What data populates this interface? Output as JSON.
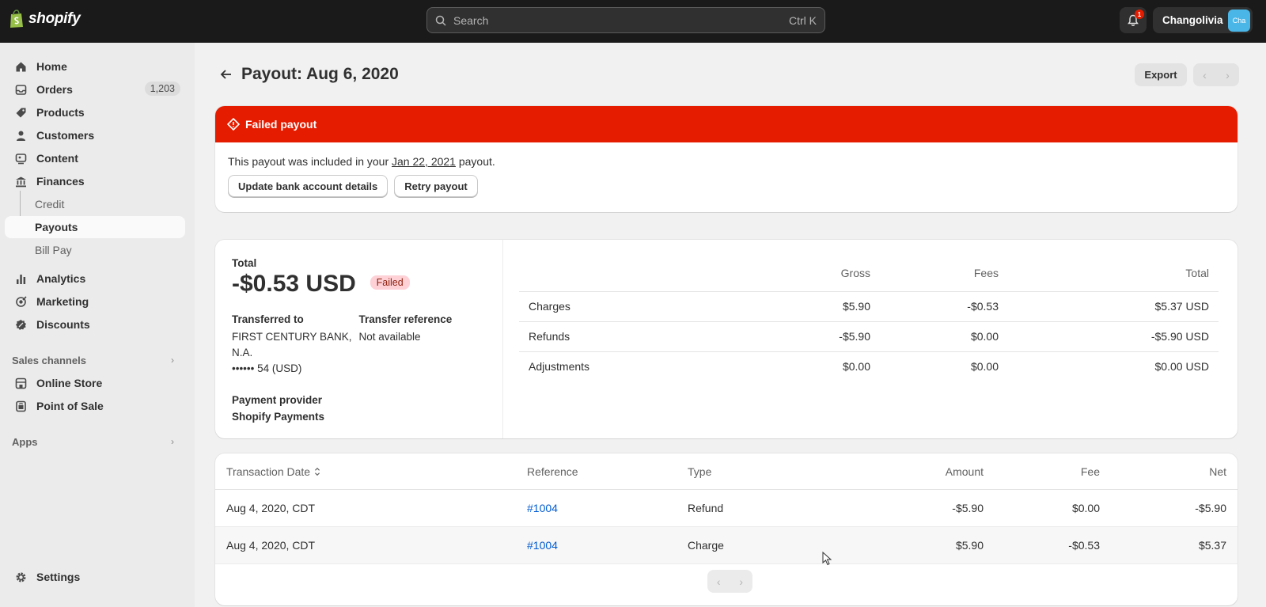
{
  "topbar": {
    "brand": "shopify",
    "search_placeholder": "Search",
    "search_shortcut": "Ctrl K",
    "notification_count": "1",
    "store_name": "Changolivia",
    "avatar_text": "Cha"
  },
  "sidebar": {
    "items": [
      {
        "label": "Home",
        "icon": "home-icon"
      },
      {
        "label": "Orders",
        "icon": "orders-icon",
        "badge": "1,203"
      },
      {
        "label": "Products",
        "icon": "tag-icon"
      },
      {
        "label": "Customers",
        "icon": "person-icon"
      },
      {
        "label": "Content",
        "icon": "content-icon"
      },
      {
        "label": "Finances",
        "icon": "bank-icon"
      },
      {
        "label": "Credit"
      },
      {
        "label": "Payouts"
      },
      {
        "label": "Bill Pay"
      },
      {
        "label": "Analytics",
        "icon": "analytics-icon"
      },
      {
        "label": "Marketing",
        "icon": "marketing-icon"
      },
      {
        "label": "Discounts",
        "icon": "discount-icon"
      }
    ],
    "sales_channels_label": "Sales channels",
    "channels": [
      {
        "label": "Online Store",
        "icon": "store-icon"
      },
      {
        "label": "Point of Sale",
        "icon": "pos-icon"
      }
    ],
    "apps_label": "Apps",
    "settings_label": "Settings"
  },
  "page": {
    "title": "Payout: Aug 6, 2020",
    "export_label": "Export"
  },
  "banner": {
    "title": "Failed payout",
    "text_before": "This payout was included in your ",
    "link": "Jan 22, 2021",
    "text_after": " payout.",
    "update_button": "Update bank account details",
    "retry_button": "Retry payout"
  },
  "summary": {
    "total_label": "Total",
    "total_amount": "-$0.53 USD",
    "status": "Failed",
    "transferred_label": "Transferred to",
    "bank_name": "FIRST CENTURY BANK, N.A.",
    "account": "•••••• 54 (USD)",
    "reference_label": "Transfer reference",
    "reference_value": "Not available",
    "provider_label": "Payment provider",
    "provider_value": "Shopify Payments",
    "table": {
      "headers": {
        "gross": "Gross",
        "fees": "Fees",
        "total": "Total"
      },
      "rows": [
        {
          "name": "Charges",
          "gross": "$5.90",
          "fees": "-$0.53",
          "total": "$5.37 USD"
        },
        {
          "name": "Refunds",
          "gross": "-$5.90",
          "fees": "$0.00",
          "total": "-$5.90 USD"
        },
        {
          "name": "Adjustments",
          "gross": "$0.00",
          "fees": "$0.00",
          "total": "$0.00 USD"
        }
      ]
    }
  },
  "transactions": {
    "headers": {
      "date": "Transaction Date",
      "reference": "Reference",
      "type": "Type",
      "amount": "Amount",
      "fee": "Fee",
      "net": "Net"
    },
    "rows": [
      {
        "date": "Aug 4, 2020, CDT",
        "reference": "#1004",
        "type": "Refund",
        "amount": "-$5.90",
        "fee": "$0.00",
        "net": "-$5.90"
      },
      {
        "date": "Aug 4, 2020, CDT",
        "reference": "#1004",
        "type": "Charge",
        "amount": "$5.90",
        "fee": "-$0.53",
        "net": "$5.37"
      }
    ]
  },
  "colors": {
    "topbar": "#1a1a1a",
    "critical": "#e51c00",
    "link": "#005bd3",
    "badge_critical_bg": "#fed1d7"
  }
}
